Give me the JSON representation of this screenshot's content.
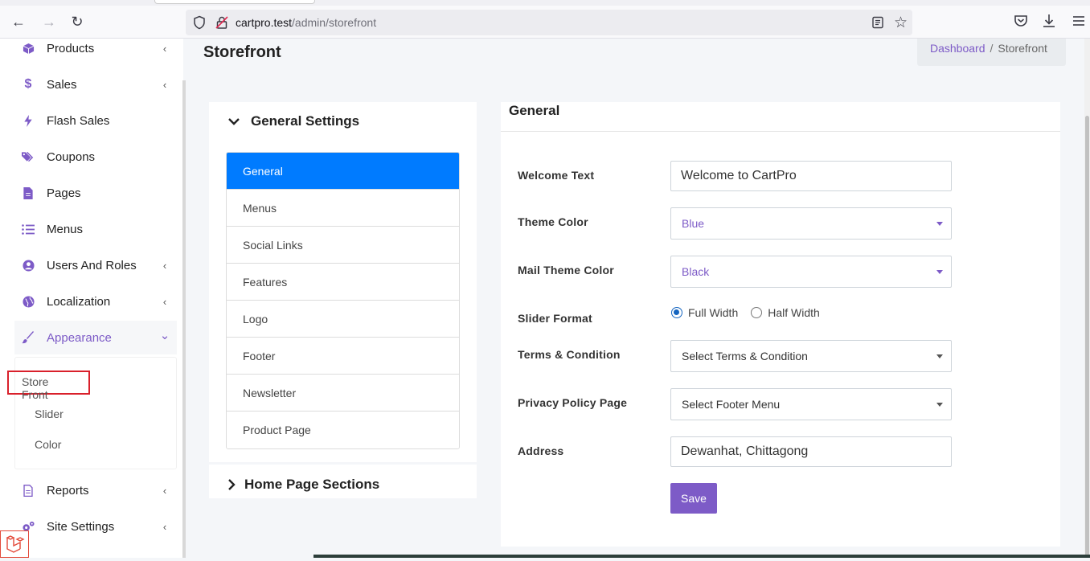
{
  "browser": {
    "url_host": "cartpro.test",
    "url_path": "/admin/storefront"
  },
  "sidebar": {
    "items": [
      {
        "label": "Products",
        "icon": "cube-icon",
        "chevron": "‹"
      },
      {
        "label": "Sales",
        "icon": "dollar-icon",
        "chevron": "‹"
      },
      {
        "label": "Flash Sales",
        "icon": "bolt-icon",
        "chevron": ""
      },
      {
        "label": "Coupons",
        "icon": "tags-icon",
        "chevron": ""
      },
      {
        "label": "Pages",
        "icon": "file-icon",
        "chevron": ""
      },
      {
        "label": "Menus",
        "icon": "list-icon",
        "chevron": ""
      },
      {
        "label": "Users And Roles",
        "icon": "user-circle-icon",
        "chevron": "‹"
      },
      {
        "label": "Localization",
        "icon": "globe-icon",
        "chevron": "‹"
      },
      {
        "label": "Appearance",
        "icon": "brush-icon",
        "chevron": "⌄"
      },
      {
        "label": "Reports",
        "icon": "report-icon",
        "chevron": "‹"
      },
      {
        "label": "Site Settings",
        "icon": "cogs-icon",
        "chevron": "‹"
      }
    ],
    "appearance_sub": [
      "Store Front",
      "Slider",
      "Color"
    ]
  },
  "page": {
    "title": "Storefront",
    "breadcrumb": {
      "home": "Dashboard",
      "sep": "/",
      "current": "Storefront"
    }
  },
  "settings": {
    "heading": "General Settings",
    "items": [
      "General",
      "Menus",
      "Social Links",
      "Features",
      "Logo",
      "Footer",
      "Newsletter",
      "Product Page"
    ],
    "home_heading": "Home Page Sections"
  },
  "form": {
    "title": "General",
    "welcome_label": "Welcome Text",
    "welcome_value": "Welcome to CartPro",
    "theme_label": "Theme Color",
    "theme_value": "Blue",
    "mail_label": "Mail Theme Color",
    "mail_value": "Black",
    "slider_label": "Slider Format",
    "slider_opt1": "Full Width",
    "slider_opt2": "Half Width",
    "terms_label": "Terms & Condition",
    "terms_value": "Select Terms & Condition",
    "privacy_label": "Privacy Policy Page",
    "privacy_value": "Select Footer Menu",
    "address_label": "Address",
    "address_value": "Dewanhat, Chittagong",
    "save_label": "Save"
  },
  "colors": {
    "accent": "#7d5bc7",
    "active": "#007bff"
  }
}
